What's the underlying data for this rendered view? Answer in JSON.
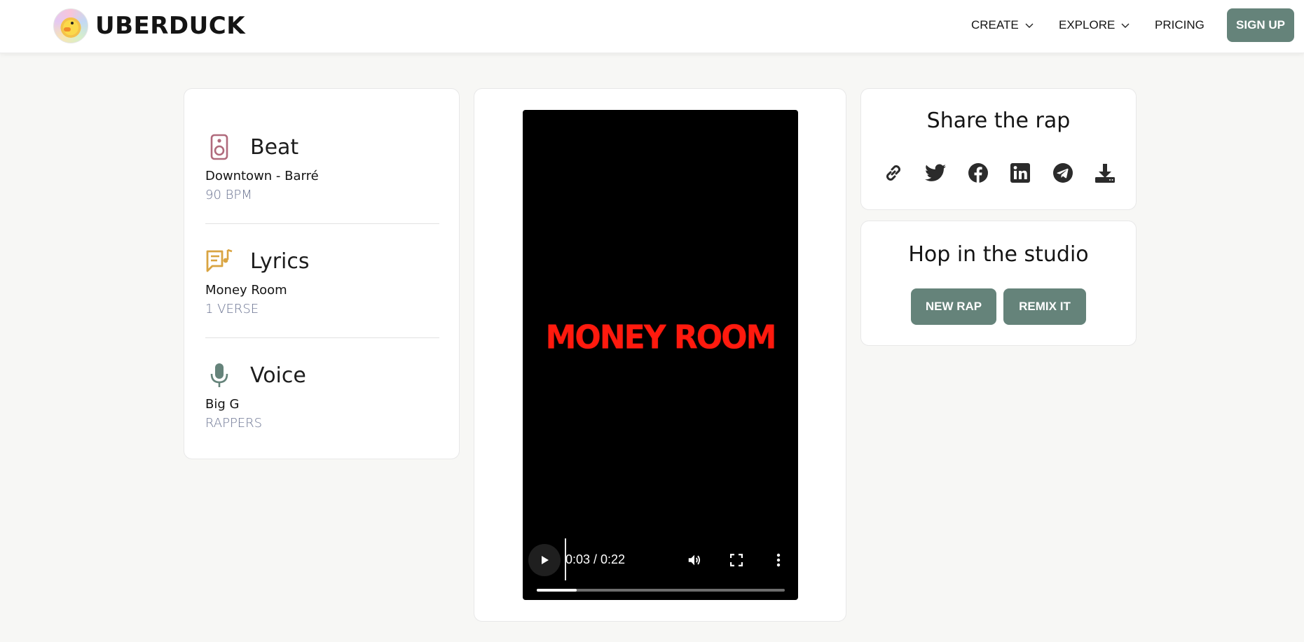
{
  "header": {
    "logo_text": "UBERDUCK",
    "nav": {
      "create": "CREATE",
      "explore": "EXPLORE",
      "pricing": "PRICING"
    },
    "signup_label": "SIGN UP"
  },
  "info": {
    "beat": {
      "title": "Beat",
      "name": "Downtown - Barré",
      "meta": "90 BPM",
      "icon": "speaker-icon",
      "icon_color": "#b06a7c"
    },
    "lyrics": {
      "title": "Lyrics",
      "name": "Money Room",
      "meta": "1 VERSE",
      "icon": "lyrics-note-icon",
      "icon_color": "#d9a441"
    },
    "voice": {
      "title": "Voice",
      "name": "Big G",
      "meta": "RAPPERS",
      "icon": "microphone-icon",
      "icon_color": "#65837a"
    }
  },
  "video": {
    "title_text": "MONEY ROOM",
    "time": "0:03 / 0:22",
    "progress": 0.16,
    "title_color": "#ff1a0e"
  },
  "share": {
    "heading": "Share the rap",
    "icons": [
      "link-icon",
      "twitter-icon",
      "facebook-icon",
      "linkedin-icon",
      "telegram-icon",
      "download-icon"
    ]
  },
  "studio": {
    "heading": "Hop in the studio",
    "new_rap_label": "NEW RAP",
    "remix_label": "REMIX IT"
  },
  "colors": {
    "accent": "#65837a",
    "meta_text": "#6a7391",
    "background": "#f7f7f5"
  }
}
